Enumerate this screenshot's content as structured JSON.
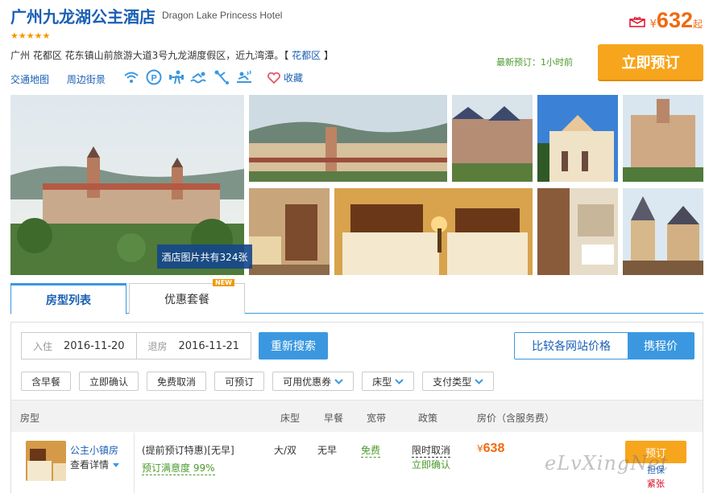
{
  "hotel": {
    "name": "广州九龙湖公主酒店",
    "name_en": "Dragon Lake Princess Hotel",
    "stars": "★★★★★",
    "address_prefix": "广州 花都区 花东镇山前旅游大道3号九龙湖度假区，近九湾潭。【",
    "district": "花都区",
    "address_suffix": "】",
    "links": [
      "交通地图",
      "周边街景"
    ],
    "facility_icons": [
      "wifi-icon",
      "parking-icon",
      "fitness-icon",
      "swimming-icon",
      "golf-icon",
      "spa-icon"
    ],
    "favorite_label": "收藏",
    "photo_count": "酒店图片共有324张"
  },
  "pricing": {
    "currency": "¥",
    "price": "632",
    "suffix": "起",
    "latest_booking": "最新预订：1小时前",
    "book_label": "立即预订"
  },
  "tabs": [
    {
      "label": "房型列表",
      "active": true
    },
    {
      "label": "优惠套餐",
      "badge": "NEW"
    }
  ],
  "search": {
    "checkin_label": "入住",
    "checkin": "2016-11-20",
    "checkout_label": "退房",
    "checkout": "2016-11-21",
    "search_label": "重新搜索",
    "compare_label": "比较各网站价格",
    "compare_btn": "携程价"
  },
  "filters": [
    {
      "label": "含早餐"
    },
    {
      "label": "立即确认"
    },
    {
      "label": "免费取消"
    },
    {
      "label": "可预订"
    },
    {
      "label": "可用优惠券",
      "dropdown": true
    },
    {
      "label": "床型",
      "dropdown": true
    },
    {
      "label": "支付类型",
      "dropdown": true
    }
  ],
  "table": {
    "headers": {
      "room": "房型",
      "bed": "床型",
      "breakfast": "早餐",
      "broadband": "宽带",
      "policy": "政策",
      "price": "房价（含服务费）"
    },
    "rows": [
      {
        "room_name": "公主小镇房",
        "detail": "查看详情",
        "plan": "(提前预订特惠)[无早]",
        "satisfaction": "预订满意度 99%",
        "bed": "大/双",
        "breakfast": "无早",
        "broadband": "免费",
        "policy": "限时取消",
        "confirm": "立即确认",
        "currency": "¥",
        "price": "638",
        "book": "预订",
        "note1": "担保",
        "note2": "紧张"
      }
    ]
  },
  "watermark": "eLvXingNet",
  "colors": {
    "accent": "#3b98e0",
    "price": "#f06a0f",
    "button": "#f7a51c",
    "green": "#4b9a2c"
  }
}
